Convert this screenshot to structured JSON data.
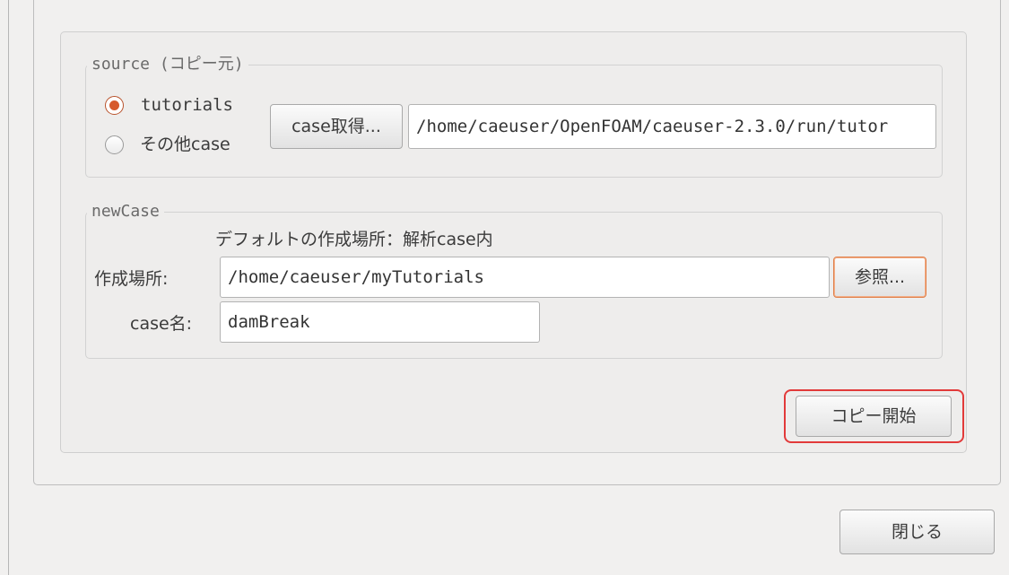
{
  "source_group": {
    "title": "source (コピー元)",
    "radio_tutorials": "tutorials",
    "radio_other": "その他case",
    "get_case_button": "case取得...",
    "path_value": "/home/caeuser/OpenFOAM/caeuser-2.3.0/run/tutor"
  },
  "newcase_group": {
    "title": "newCase",
    "default_note": "デフォルトの作成場所：解析case内",
    "location_label": "作成場所:",
    "location_value": "/home/caeuser/myTutorials",
    "browse_button": "参照...",
    "case_name_label": "case名:",
    "case_name_value": "damBreak"
  },
  "copy_start_button": "コピー開始",
  "close_button": "閉じる",
  "colors": {
    "accent": "#d65a2d",
    "highlight": "#e23a3a",
    "background": "#f1f0ef"
  }
}
